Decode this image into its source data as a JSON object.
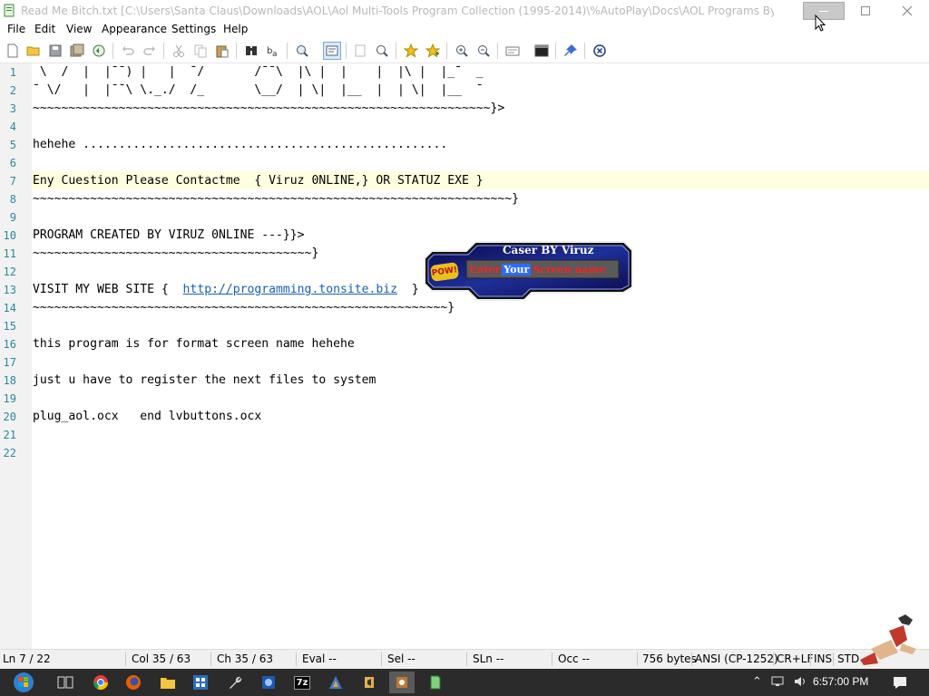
{
  "window": {
    "title": "Read Me Bitch.txt [C:\\Users\\Santa Claus\\Downloads\\AOL\\Aol Multi-Tools Program Collection (1995-2014)\\%AutoPlay\\Docs\\AOL Programs By Virus\\Viruz ..."
  },
  "menu": {
    "file": "File",
    "edit": "Edit",
    "view": "View",
    "appearance": "Appearance",
    "settings": "Settings",
    "help": "Help"
  },
  "gutter": [
    "1",
    "2",
    "3",
    "4",
    "5",
    "6",
    "7",
    "8",
    "9",
    "10",
    "11",
    "12",
    "13",
    "14",
    "15",
    "16",
    "17",
    "18",
    "19",
    "20",
    "21",
    "22"
  ],
  "lines": {
    "l1": " \\  /  |  |¯¯) |   |  ¯/       /¯¯\\  |\\ |  |    |  |\\ |  |_¯  _",
    "l2": "¯ \\/   |  |¯¯\\ \\._./  /_       \\__/  | \\|  |__  |  | \\|  |__  ¯",
    "l3": "~~~~~~~~~~~~~~~~~~~~~~~~~~~~~~~~~~~~~~~~~~~~~~~~~~~~~~~~~~~~~~~~}>",
    "l4": "",
    "l5": "hehehe ...................................................",
    "l6": "",
    "l7": "Eny Cuestion Please Contactme  { Viruz 0NLINE,} OR STATUZ EXE }",
    "l8": "~~~~~~~~~~~~~~~~~~~~~~~~~~~~~~~~~~~~~~~~~~~~~~~~~~~~~~~~~~~~~~~~~~~}",
    "l9": "",
    "l10": "PROGRAM CREATED BY VIRUZ 0NLINE ---}}>",
    "l11": "~~~~~~~~~~~~~~~~~~~~~~~~~~~~~~~~~~~~~~~}",
    "l12": "",
    "l13_pre": "VISIT MY WEB SITE {  ",
    "l13_link": "http://programming.tonsite.biz",
    "l13_post": "  }",
    "l14": "~~~~~~~~~~~~~~~~~~~~~~~~~~~~~~~~~~~~~~~~~~~~~~~~~~~~~~~~~~}",
    "l15": "",
    "l16": "this program is for format screen name hehehe",
    "l17": "",
    "l18": "just u have to register the next files to system",
    "l19": "",
    "l20": "plug_aol.ocx   end lvbuttons.ocx",
    "l21": "",
    "l22": ""
  },
  "caser": {
    "title": "Caser BY Viruz",
    "word1": "Enter",
    "word2": "Your",
    "word3": "Screen name",
    "badge": "POW!",
    "colors": {
      "red": "#ff2020",
      "blue": "#2f6bff",
      "frame": "#1a1a6e"
    }
  },
  "status": {
    "ln": "Ln  7 / 22",
    "col": "Col  35 / 63",
    "ch": "Ch  35 / 63",
    "eval": "Eval  --",
    "sel": "Sel  --",
    "sln": "SLn  --",
    "occ": "Occ  --",
    "size": "756 bytes",
    "encoding": "ANSI (CP-1252)",
    "eol": "CR+LF",
    "ins": "INS",
    "std": "STD"
  },
  "taskbar": {
    "clock": "6:57:00 PM",
    "seven_zip": "7z"
  },
  "icons": {
    "toolbar": [
      "new-file-icon",
      "open-folder-icon",
      "save-icon",
      "save-all-icon",
      "reload-icon",
      "undo-icon",
      "redo-icon",
      "cut-icon",
      "copy-icon",
      "paste-icon",
      "find-icon",
      "replace-icon",
      "find-in-files-icon",
      "word-wrap-icon",
      "select-all-icon",
      "zoom-icon",
      "favorite-icon",
      "add-favorite-icon",
      "zoom-in-icon",
      "zoom-out-icon",
      "scheme-icon",
      "command-prompt-icon",
      "pin-icon",
      "close-file-icon"
    ]
  }
}
